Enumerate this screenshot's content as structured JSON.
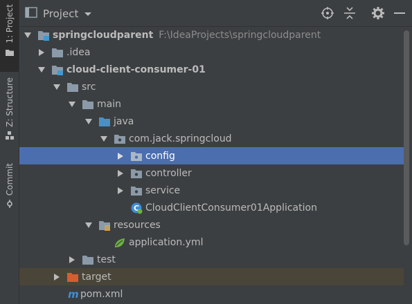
{
  "toolwindow_tabs": [
    {
      "label": "1: Project",
      "icon": "folder-icon",
      "active": true
    },
    {
      "label": "Z: Structure",
      "icon": "structure-icon",
      "active": false
    },
    {
      "label": "Commit",
      "icon": "commit-icon",
      "active": false
    }
  ],
  "header": {
    "title": "Project",
    "actions": [
      "locate-icon",
      "collapse-all-icon",
      "gear-icon",
      "hide-icon"
    ]
  },
  "tree": [
    {
      "label": "springcloudparent",
      "path": "F:\\IdeaProjects\\springcloudparent",
      "bold": true,
      "depth": 0,
      "expanded": true,
      "icon": "module-folder-icon"
    },
    {
      "label": ".idea",
      "depth": 1,
      "expanded": false,
      "icon": "folder-icon"
    },
    {
      "label": "cloud-client-consumer-01",
      "bold": true,
      "depth": 1,
      "expanded": true,
      "icon": "module-folder-icon"
    },
    {
      "label": "src",
      "depth": 2,
      "expanded": true,
      "icon": "folder-icon"
    },
    {
      "label": "main",
      "depth": 3,
      "expanded": true,
      "icon": "folder-icon"
    },
    {
      "label": "java",
      "depth": 4,
      "expanded": true,
      "icon": "source-folder-icon"
    },
    {
      "label": "com.jack.springcloud",
      "depth": 5,
      "expanded": true,
      "icon": "package-icon"
    },
    {
      "label": "config",
      "depth": 6,
      "expanded": false,
      "icon": "package-icon",
      "selected": true
    },
    {
      "label": "controller",
      "depth": 6,
      "expanded": false,
      "icon": "package-icon"
    },
    {
      "label": "service",
      "depth": 6,
      "expanded": false,
      "icon": "package-icon"
    },
    {
      "label": "CloudClientConsumer01Application",
      "depth": 6,
      "leaf": true,
      "icon": "spring-class-icon"
    },
    {
      "label": "resources",
      "depth": 4,
      "expanded": true,
      "icon": "resources-folder-icon"
    },
    {
      "label": "application.yml",
      "depth": 5,
      "leaf": true,
      "icon": "spring-yml-icon"
    },
    {
      "label": "test",
      "depth": 3,
      "expanded": false,
      "icon": "folder-icon"
    },
    {
      "label": "target",
      "depth": 2,
      "expanded": false,
      "icon": "excluded-folder-icon",
      "excluded": true
    },
    {
      "label": "pom.xml",
      "depth": 2,
      "leaf": true,
      "icon": "maven-icon"
    }
  ],
  "colors": {
    "background": "#3c3f41",
    "selection": "#4b6eaf",
    "excluded_row": "#4a4539",
    "folder": "#8b9aa8",
    "source_folder": "#4a90c4",
    "excluded_folder": "#d65e2e"
  }
}
